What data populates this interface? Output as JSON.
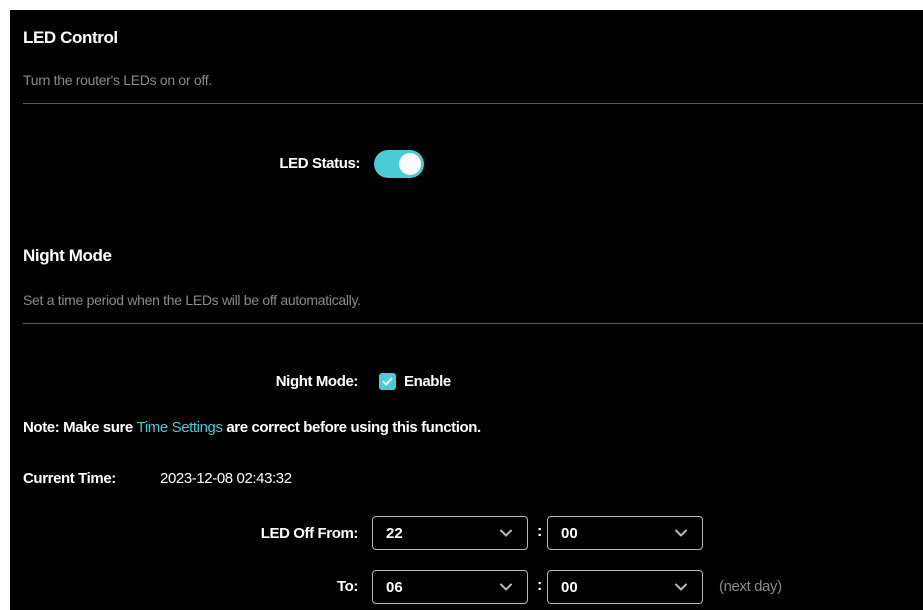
{
  "led_control": {
    "title": "LED Control",
    "description": "Turn the router's LEDs on or off.",
    "status_label": "LED Status:",
    "status_on": true
  },
  "night_mode": {
    "title": "Night Mode",
    "description": "Set a time period when the LEDs will be off automatically.",
    "mode_label": "Night Mode:",
    "enable_label": "Enable",
    "enabled": true,
    "note_prefix": "Note:",
    "note_text_before": " Make sure ",
    "note_link": "Time Settings",
    "note_text_after": " are correct before using this function.",
    "current_time_label": "Current Time:",
    "current_time_value": "2023-12-08 02:43:32",
    "off_from_label": "LED Off From:",
    "off_from_hour": "22",
    "off_from_minute": "00",
    "to_label": "To:",
    "to_hour": "06",
    "to_minute": "00",
    "separator": ":",
    "next_day_label": "(next day)"
  },
  "colors": {
    "background": "#000000",
    "accent": "#4acbd6",
    "muted_text": "#8a8a8a",
    "divider": "#5a5a5a"
  },
  "icons": {
    "dropdown": "chevron-down-icon",
    "check": "checkmark-icon"
  }
}
